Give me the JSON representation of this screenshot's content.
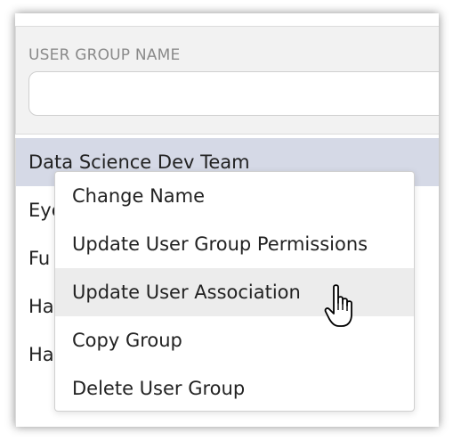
{
  "filter": {
    "label": "USER GROUP NAME",
    "value": "",
    "placeholder": ""
  },
  "list": {
    "rows": [
      {
        "label": "Data Science Dev Team",
        "selected": true
      },
      {
        "label": "Eye",
        "selected": false
      },
      {
        "label": "Fu",
        "selected": false
      },
      {
        "label": "Ha",
        "selected": false
      },
      {
        "label": "Ha",
        "selected": false
      }
    ]
  },
  "context_menu": {
    "items": [
      {
        "label": "Change Name"
      },
      {
        "label": "Update User Group Permissions"
      },
      {
        "label": "Update User Association",
        "hovered": true
      },
      {
        "label": "Copy Group"
      },
      {
        "label": "Delete User Group"
      }
    ]
  },
  "cursor": {
    "icon": "hand-pointer-icon"
  },
  "colors": {
    "selected_row": "#d5d9e6",
    "hover_item": "#ececec",
    "panel_bg": "#f2f2f2"
  }
}
